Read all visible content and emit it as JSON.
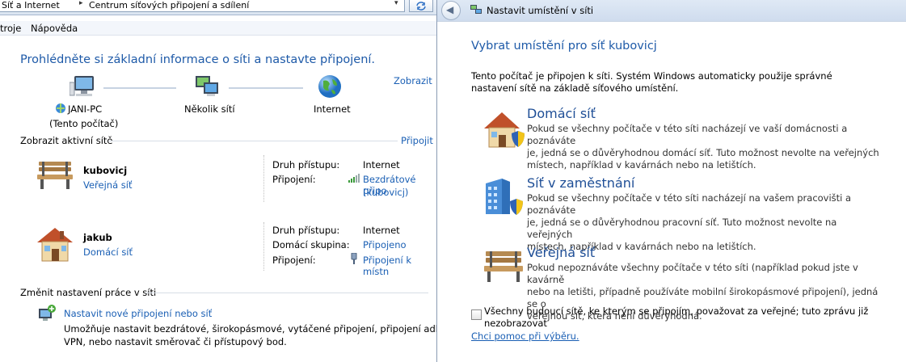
{
  "background_window": {
    "breadcrumb": [
      "Síť a Internet",
      "Centrum síťových připojení a sdílení"
    ],
    "menu": [
      "troje",
      "Nápověda"
    ],
    "heading": "Prohlédněte si základní informace o síti a nastavte připojení.",
    "show_full_map_link": "Zobrazit",
    "map": [
      {
        "label": "JANI-PC",
        "sublabel": "(Tento počítač)",
        "icon": "computer-icon"
      },
      {
        "label": "Několik sítí",
        "icon": "multiple-networks-icon"
      },
      {
        "label": "Internet",
        "icon": "globe-icon"
      }
    ],
    "active_networks_heading": "Zobrazit aktivní sítě",
    "connect_link": "Připojit",
    "networks": [
      {
        "name": "kubovicj",
        "type_link": "Veřejná síť",
        "icon": "park-bench-icon",
        "rows": [
          {
            "label": "Druh přístupu:",
            "value": "Internet"
          },
          {
            "label": "Připojení:",
            "value": "Bezdrátové připo",
            "value2": "(kubovicj)",
            "icon": "wifi-signal-icon"
          }
        ]
      },
      {
        "name": "jakub",
        "type_link": "Domácí síť",
        "icon": "house-icon",
        "rows": [
          {
            "label": "Druh přístupu:",
            "value": "Internet"
          },
          {
            "label": "Domácí skupina:",
            "value": "Připojeno"
          },
          {
            "label": "Připojení:",
            "value": "Připojení k místn",
            "icon": "lan-plug-icon"
          }
        ]
      }
    ],
    "change_settings_heading": "Změnit nastavení práce v síti",
    "setup_link": "Nastavit nové připojení nebo síť",
    "setup_desc_line1": "Umožňuje nastavit bezdrátové, širokopásmové, vytáčené připojení, připojení adhoc nebo",
    "setup_desc_line2": "VPN, nebo nastavit směrovač či přístupový bod."
  },
  "dialog": {
    "title": "Nastavit umístění v síti",
    "heading": "Vybrat umístění pro síť kubovicj",
    "intro_line1": "Tento počítač je připojen k síti. Systém Windows automaticky použije správné",
    "intro_line2": "nastavení sítě na základě síťového umístění.",
    "options": [
      {
        "title": "Domácí síť",
        "icon": "home-network-icon",
        "lines": [
          "Pokud se všechny počítače v této síti nacházejí ve vaší domácnosti a poznáváte",
          "je, jedná se o důvěryhodnou domácí síť. Tuto možnost nevolte na veřejných",
          "místech, například v kavárnách nebo na letištích."
        ]
      },
      {
        "title": "Síť v zaměstnání",
        "icon": "work-network-icon",
        "lines": [
          "Pokud se všechny počítače v této síti nacházejí na vašem pracovišti a poznáváte",
          "je, jedná se o důvěryhodnou pracovní síť. Tuto možnost nevolte na veřejných",
          "místech, například v kavárnách nebo na letištích."
        ]
      },
      {
        "title": "Veřejná síť",
        "icon": "public-network-icon",
        "lines": [
          "Pokud nepoznáváte všechny počítače v této síti (například pokud jste v kavárně",
          "nebo na letišti, případně používáte mobilní širokopásmové připojení), jedná se o",
          "veřejnou síť, která není důvěryhodná."
        ]
      }
    ],
    "checkbox_line1": "Všechny budoucí sítě, ke kterým se připojím, považovat za veřejné; tuto zprávu již",
    "checkbox_line2": "nezobrazovat",
    "help_link": "Chci pomoc při výběru."
  }
}
